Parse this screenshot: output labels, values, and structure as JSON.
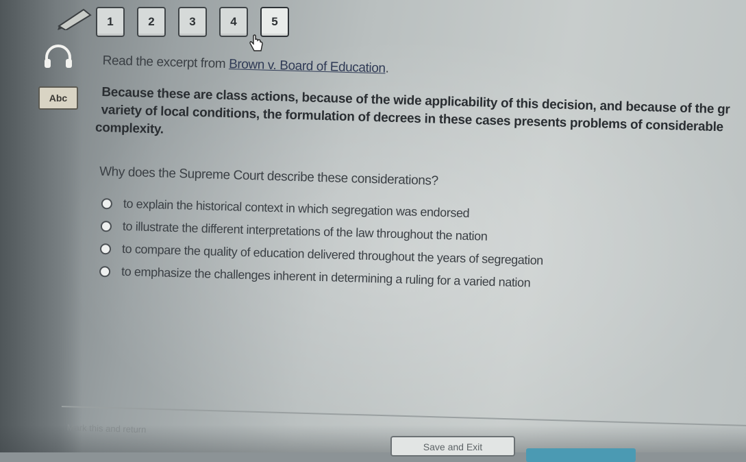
{
  "tabs": [
    {
      "label": "1"
    },
    {
      "label": "2"
    },
    {
      "label": "3"
    },
    {
      "label": "4"
    },
    {
      "label": "5"
    }
  ],
  "active_tab": "5",
  "tools": {
    "pencil_icon": "pencil-icon",
    "headphones_icon": "headphones-icon",
    "abc_label": "Abc"
  },
  "question": {
    "prompt_prefix": "Read the excerpt from ",
    "document_title": "Brown v. Board of Education",
    "prompt_suffix": ".",
    "excerpt_line1": "Because these are class actions, because of the wide applicability of this decision, and because of the gr",
    "excerpt_line2": "variety of local conditions, the formulation of decrees in these cases presents problems of considerable",
    "excerpt_line3": "complexity.",
    "stem": "Why does the Supreme Court describe these considerations?",
    "options": [
      {
        "label": "to explain the historical context in which segregation was endorsed"
      },
      {
        "label": "to illustrate the different interpretations of the law throughout the nation"
      },
      {
        "label": "to compare the quality of education delivered throughout the years of segregation"
      },
      {
        "label": "to emphasize the challenges inherent in determining a ruling for a varied nation"
      }
    ]
  },
  "footer": {
    "mark_label": "Mark this and return",
    "save_label": "Save and Exit"
  },
  "colors": {
    "submit_accent": "#4b9ab3"
  }
}
